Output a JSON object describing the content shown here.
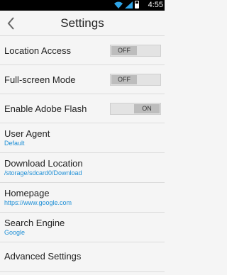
{
  "status_bar": {
    "time": "4:55"
  },
  "action_bar": {
    "title": "Settings"
  },
  "settings": {
    "location_access": {
      "label": "Location Access",
      "state": "OFF"
    },
    "full_screen": {
      "label": "Full-screen Mode",
      "state": "OFF"
    },
    "adobe_flash": {
      "label": "Enable Adobe Flash",
      "state": "ON"
    },
    "user_agent": {
      "label": "User Agent",
      "value": "Default"
    },
    "download_location": {
      "label": "Download Location",
      "value": "/storage/sdcard0/Download"
    },
    "homepage": {
      "label": "Homepage",
      "value": "https://www.google.com"
    },
    "search_engine": {
      "label": "Search Engine",
      "value": "Google"
    },
    "advanced": {
      "label": "Advanced Settings"
    }
  },
  "colors": {
    "accent": "#1e8fd6",
    "status_bar": "#000000",
    "background": "#f5f5f5"
  },
  "icons": {
    "back": "chevron-left-icon",
    "wifi": "wifi-icon",
    "signal": "signal-icon",
    "battery": "battery-icon"
  }
}
